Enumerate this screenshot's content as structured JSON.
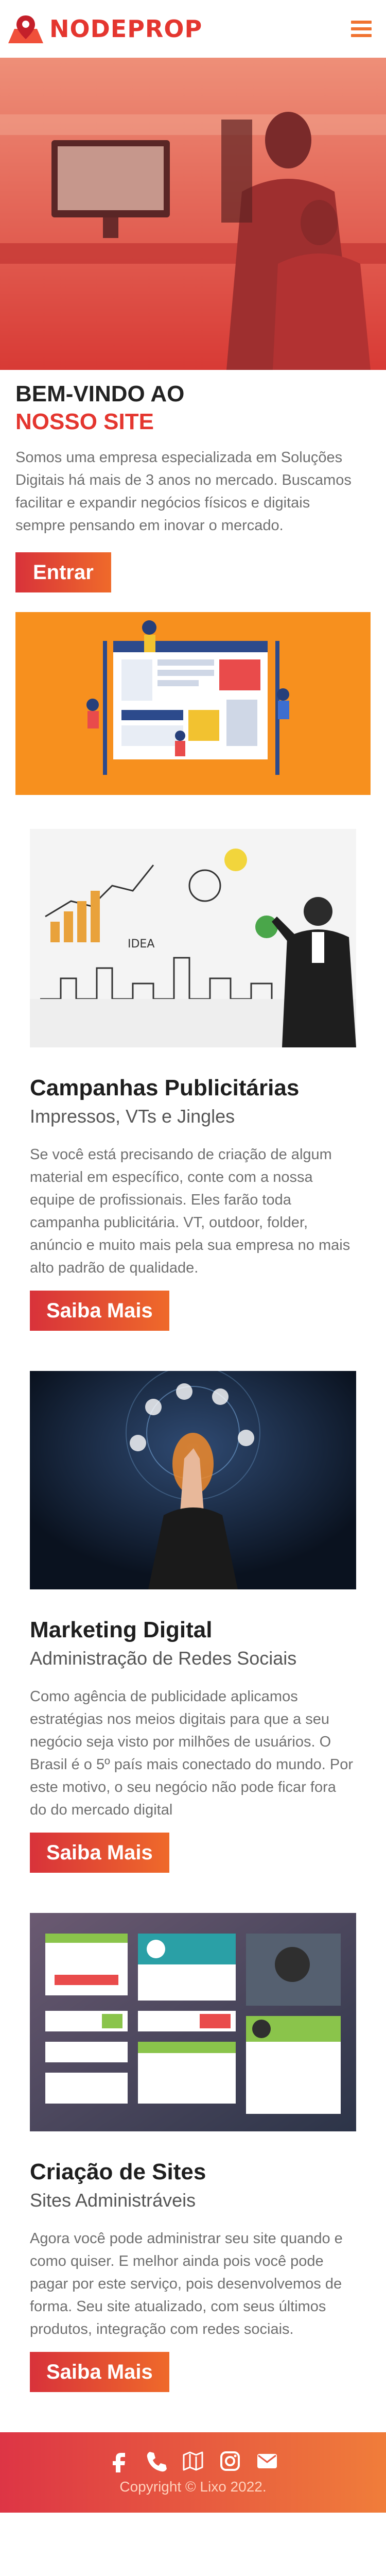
{
  "header": {
    "logo_text": "NODEPROP",
    "logo_icon": "map-pin-icon",
    "menu_icon": "hamburger-menu-icon"
  },
  "hero": {
    "image_alt": "Equipe trabalhando em computadores"
  },
  "intro": {
    "title_line1": "BEM-VINDO AO",
    "title_line2": "NOSSO SITE",
    "text": "Somos uma empresa especializada em Soluções Digitais há mais de 3 anos no mercado. Buscamos facilitar e expandir negócios físicos e digitais sempre pensando em inovar o mercado.",
    "button_label": "Entrar"
  },
  "services": [
    {
      "title": "Campanhas Publicitárias",
      "subtitle": "Impressos, VTs e Jingles",
      "text": "Se você está precisando de criação de algum material em específico, conte com a nossa equipe de profissionais. Eles farão toda campanha publicitária. VT, outdoor, folder, anúncio e muito mais pela sua empresa no mais alto padrão de qualidade.",
      "button_label": "Saiba Mais"
    },
    {
      "title": "Marketing Digital",
      "subtitle": "Administração de Redes Sociais",
      "text": "Como agência de publicidade aplicamos estratégias nos meios digitais para que a seu negócio seja visto por milhões de usuários. O Brasil é o 5º país mais conectado do mundo. Por este motivo, o seu negócio não pode ficar fora do do mercado digital",
      "button_label": "Saiba Mais"
    },
    {
      "title": "Criação de Sites",
      "subtitle": "Sites Administráveis",
      "text": "Agora você pode administrar seu site quando e como quiser. E melhor ainda pois você pode pagar por este serviço, pois desenvolvemos de forma. Seu site atualizado, com seus últimos produtos, integração com redes sociais.",
      "button_label": "Saiba Mais"
    }
  ],
  "footer": {
    "social_icons": [
      "facebook-icon",
      "phone-icon",
      "map-icon",
      "instagram-icon",
      "email-icon"
    ],
    "copyright": "Copyright © Lixo 2022."
  },
  "colors": {
    "brand_red": "#e4362f",
    "brand_orange": "#f07230",
    "banner_orange": "#f7901e"
  }
}
